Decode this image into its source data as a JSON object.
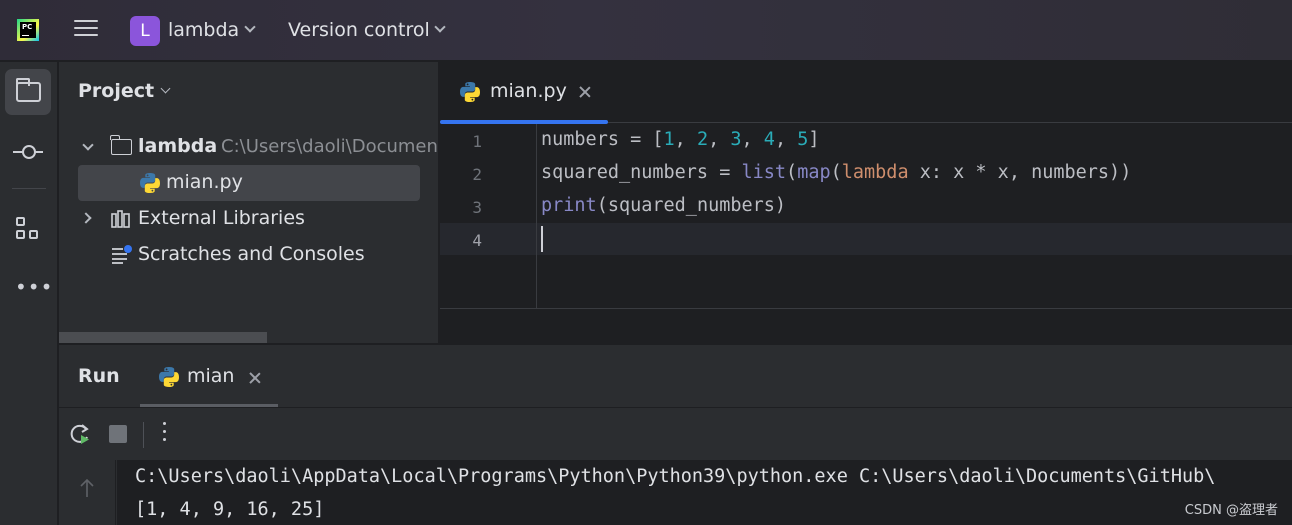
{
  "titlebar": {
    "project_initial": "L",
    "project_name": "lambda",
    "version_control_label": "Version control"
  },
  "project_panel": {
    "title": "Project",
    "tree": {
      "root_label": "lambda",
      "root_path": "C:\\Users\\daoli\\Documents",
      "file_label": "mian.py",
      "external_libraries_label": "External Libraries",
      "scratches_label": "Scratches and Consoles"
    }
  },
  "editor": {
    "tab_label": "mian.py",
    "line_numbers": [
      "1",
      "2",
      "3",
      "4"
    ],
    "code": {
      "line1": [
        "numbers = [",
        "1",
        ", ",
        "2",
        ", ",
        "3",
        ", ",
        "4",
        ", ",
        "5",
        "]"
      ],
      "line2": [
        "squared_numbers = ",
        "list",
        "(",
        "map",
        "(",
        "lambda",
        " x: x * x, numbers))"
      ],
      "line3": [
        "print",
        "(squared_numbers)"
      ]
    }
  },
  "run_panel": {
    "title": "Run",
    "tab_label": "mian",
    "console_lines": [
      "C:\\Users\\daoli\\AppData\\Local\\Programs\\Python\\Python39\\python.exe C:\\Users\\daoli\\Documents\\GitHub\\",
      "[1, 4, 9, 16, 25]"
    ]
  },
  "watermark": "CSDN @盗理者",
  "colors": {
    "accent_blue": "#3574f0",
    "project_badge": "#8b55db",
    "number": "#2aacb8",
    "builtin": "#8888c6",
    "keyword": "#cf8e6d"
  }
}
